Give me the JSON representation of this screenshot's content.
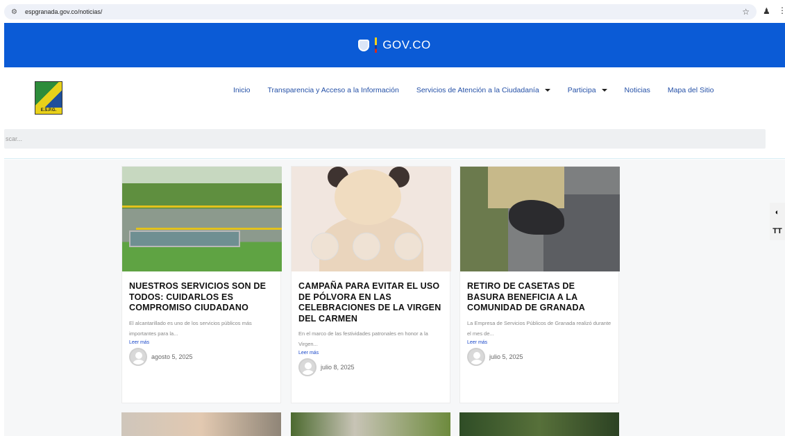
{
  "browser": {
    "url": "espgranada.gov.co/noticias/",
    "tune_icon": "tune-icon",
    "star_icon": "star-icon",
    "menu_icon": "kebab-menu-icon"
  },
  "gov_bar": {
    "label": "GOV.CO",
    "color": "#0b5bd6"
  },
  "header": {
    "logo_text": "E.S.P.G.",
    "nav": [
      {
        "label": "Inicio",
        "dropdown": false
      },
      {
        "label": "Transparencia y Acceso a la Información",
        "dropdown": false
      },
      {
        "label": "Servicios de Atención a la Ciudadanía",
        "dropdown": true
      },
      {
        "label": "Participa",
        "dropdown": true
      },
      {
        "label": "Noticias",
        "dropdown": false
      },
      {
        "label": "Mapa del Sitio",
        "dropdown": false
      }
    ],
    "search_placeholder": "scar..."
  },
  "posts": [
    {
      "title": "NUESTROS SERVICIOS SON DE TODOS: CUIDARLOS ES COMPROMISO CIUDADANO",
      "excerpt": "El alcantarillado es uno de los servicios públicos más importantes para la...",
      "more": "Leer más",
      "date": "agosto 5, 2025"
    },
    {
      "title": "CAMPAÑA PARA EVITAR EL USO DE PÓLVORA EN LAS CELEBRACIONES DE LA VIRGEN DEL CARMEN",
      "excerpt": "En el marco de las festividades patronales en honor a la Virgen...",
      "more": "Leer más",
      "date": "julio 8, 2025"
    },
    {
      "title": "RETIRO DE CASETAS DE BASURA BENEFICIA A LA COMUNIDAD DE GRANADA",
      "excerpt": "La Empresa de Servicios Públicos de Granada realizó durante el mes de...",
      "more": "Leer más",
      "date": "julio 5, 2025"
    }
  ],
  "tools": {
    "contrast_icon": "contrast-icon",
    "text_size_icon": "text-size-icon"
  }
}
